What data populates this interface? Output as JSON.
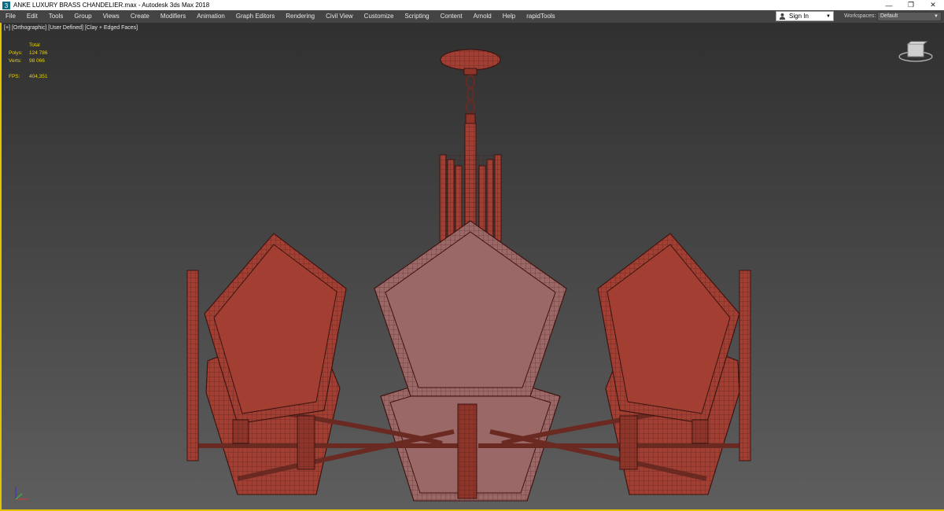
{
  "window": {
    "title": "ANKE LUXURY BRASS CHANDELIER.max - Autodesk 3ds Max 2018",
    "controls": [
      "—",
      "❐",
      "✕"
    ]
  },
  "menu": {
    "items": [
      "File",
      "Edit",
      "Tools",
      "Group",
      "Views",
      "Create",
      "Modifiers",
      "Animation",
      "Graph Editors",
      "Rendering",
      "Civil View",
      "Customize",
      "Scripting",
      "Content",
      "Arnold",
      "Help",
      "rapidTools"
    ]
  },
  "account": {
    "sign_in_label": "Sign In",
    "dropdown_icon": "▼"
  },
  "workspaces": {
    "label": "Workspaces:",
    "value": "Default",
    "dropdown_icon": "▼"
  },
  "viewport": {
    "label_parts": [
      "[+]",
      "[Orthographic]",
      "[User Defined]",
      "[Clay + Edged Faces]"
    ],
    "stats": {
      "header": "Total",
      "polys_label": "Polys:",
      "polys_value": "124 786",
      "verts_label": "Verts:",
      "verts_value": "98 066",
      "fps_label": "FPS:",
      "fps_value": "404,351"
    }
  },
  "colors": {
    "viewport_border": "#e4c400",
    "stats_text": "#e6d200",
    "model_fill": "#a23f32",
    "model_front": "#9b6868",
    "model_wire": "#3d1410"
  }
}
